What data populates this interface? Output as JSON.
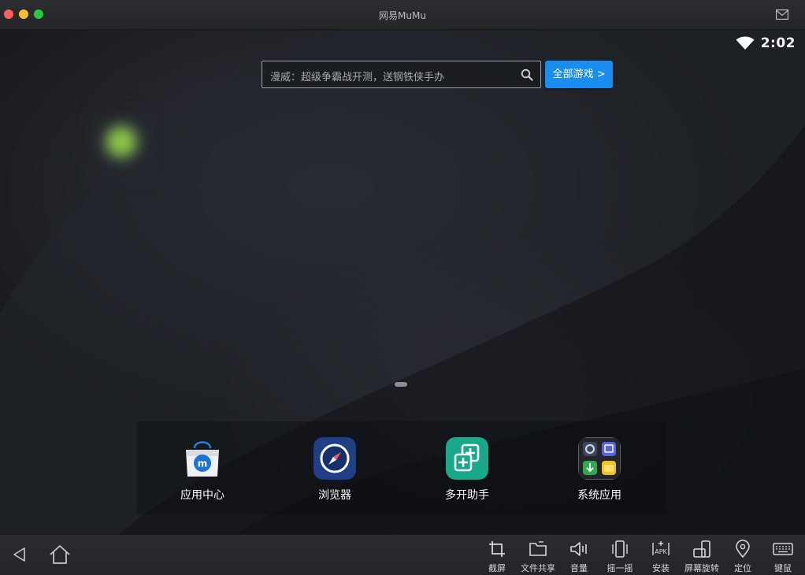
{
  "window": {
    "title": "网易MuMu"
  },
  "statusbar": {
    "time": "2:02"
  },
  "search": {
    "placeholder": "漫威：超级争霸战开测，送钢铁侠手办",
    "button_label": "全部游戏 >"
  },
  "dock": {
    "apps": [
      {
        "label": "应用中心",
        "icon": "app-center-bag-icon"
      },
      {
        "label": "浏览器",
        "icon": "compass-browser-icon"
      },
      {
        "label": "多开助手",
        "icon": "multi-instance-icon"
      },
      {
        "label": "系统应用",
        "icon": "system-apps-folder-icon"
      }
    ]
  },
  "toolbar": {
    "items": [
      {
        "label": "截屏",
        "icon": "crop-icon"
      },
      {
        "label": "文件共享",
        "icon": "folder-icon"
      },
      {
        "label": "音量",
        "icon": "volume-icon"
      },
      {
        "label": "摇一摇",
        "icon": "shake-icon"
      },
      {
        "label": "安装",
        "icon": "apk-install-icon"
      },
      {
        "label": "屏幕旋转",
        "icon": "rotate-icon"
      },
      {
        "label": "定位",
        "icon": "location-icon"
      },
      {
        "label": "键鼠",
        "icon": "keyboard-icon"
      }
    ]
  },
  "colors": {
    "accent": "#1a8df0",
    "titlebar": "#2b2d31",
    "screen_bg": "#181a1e"
  }
}
